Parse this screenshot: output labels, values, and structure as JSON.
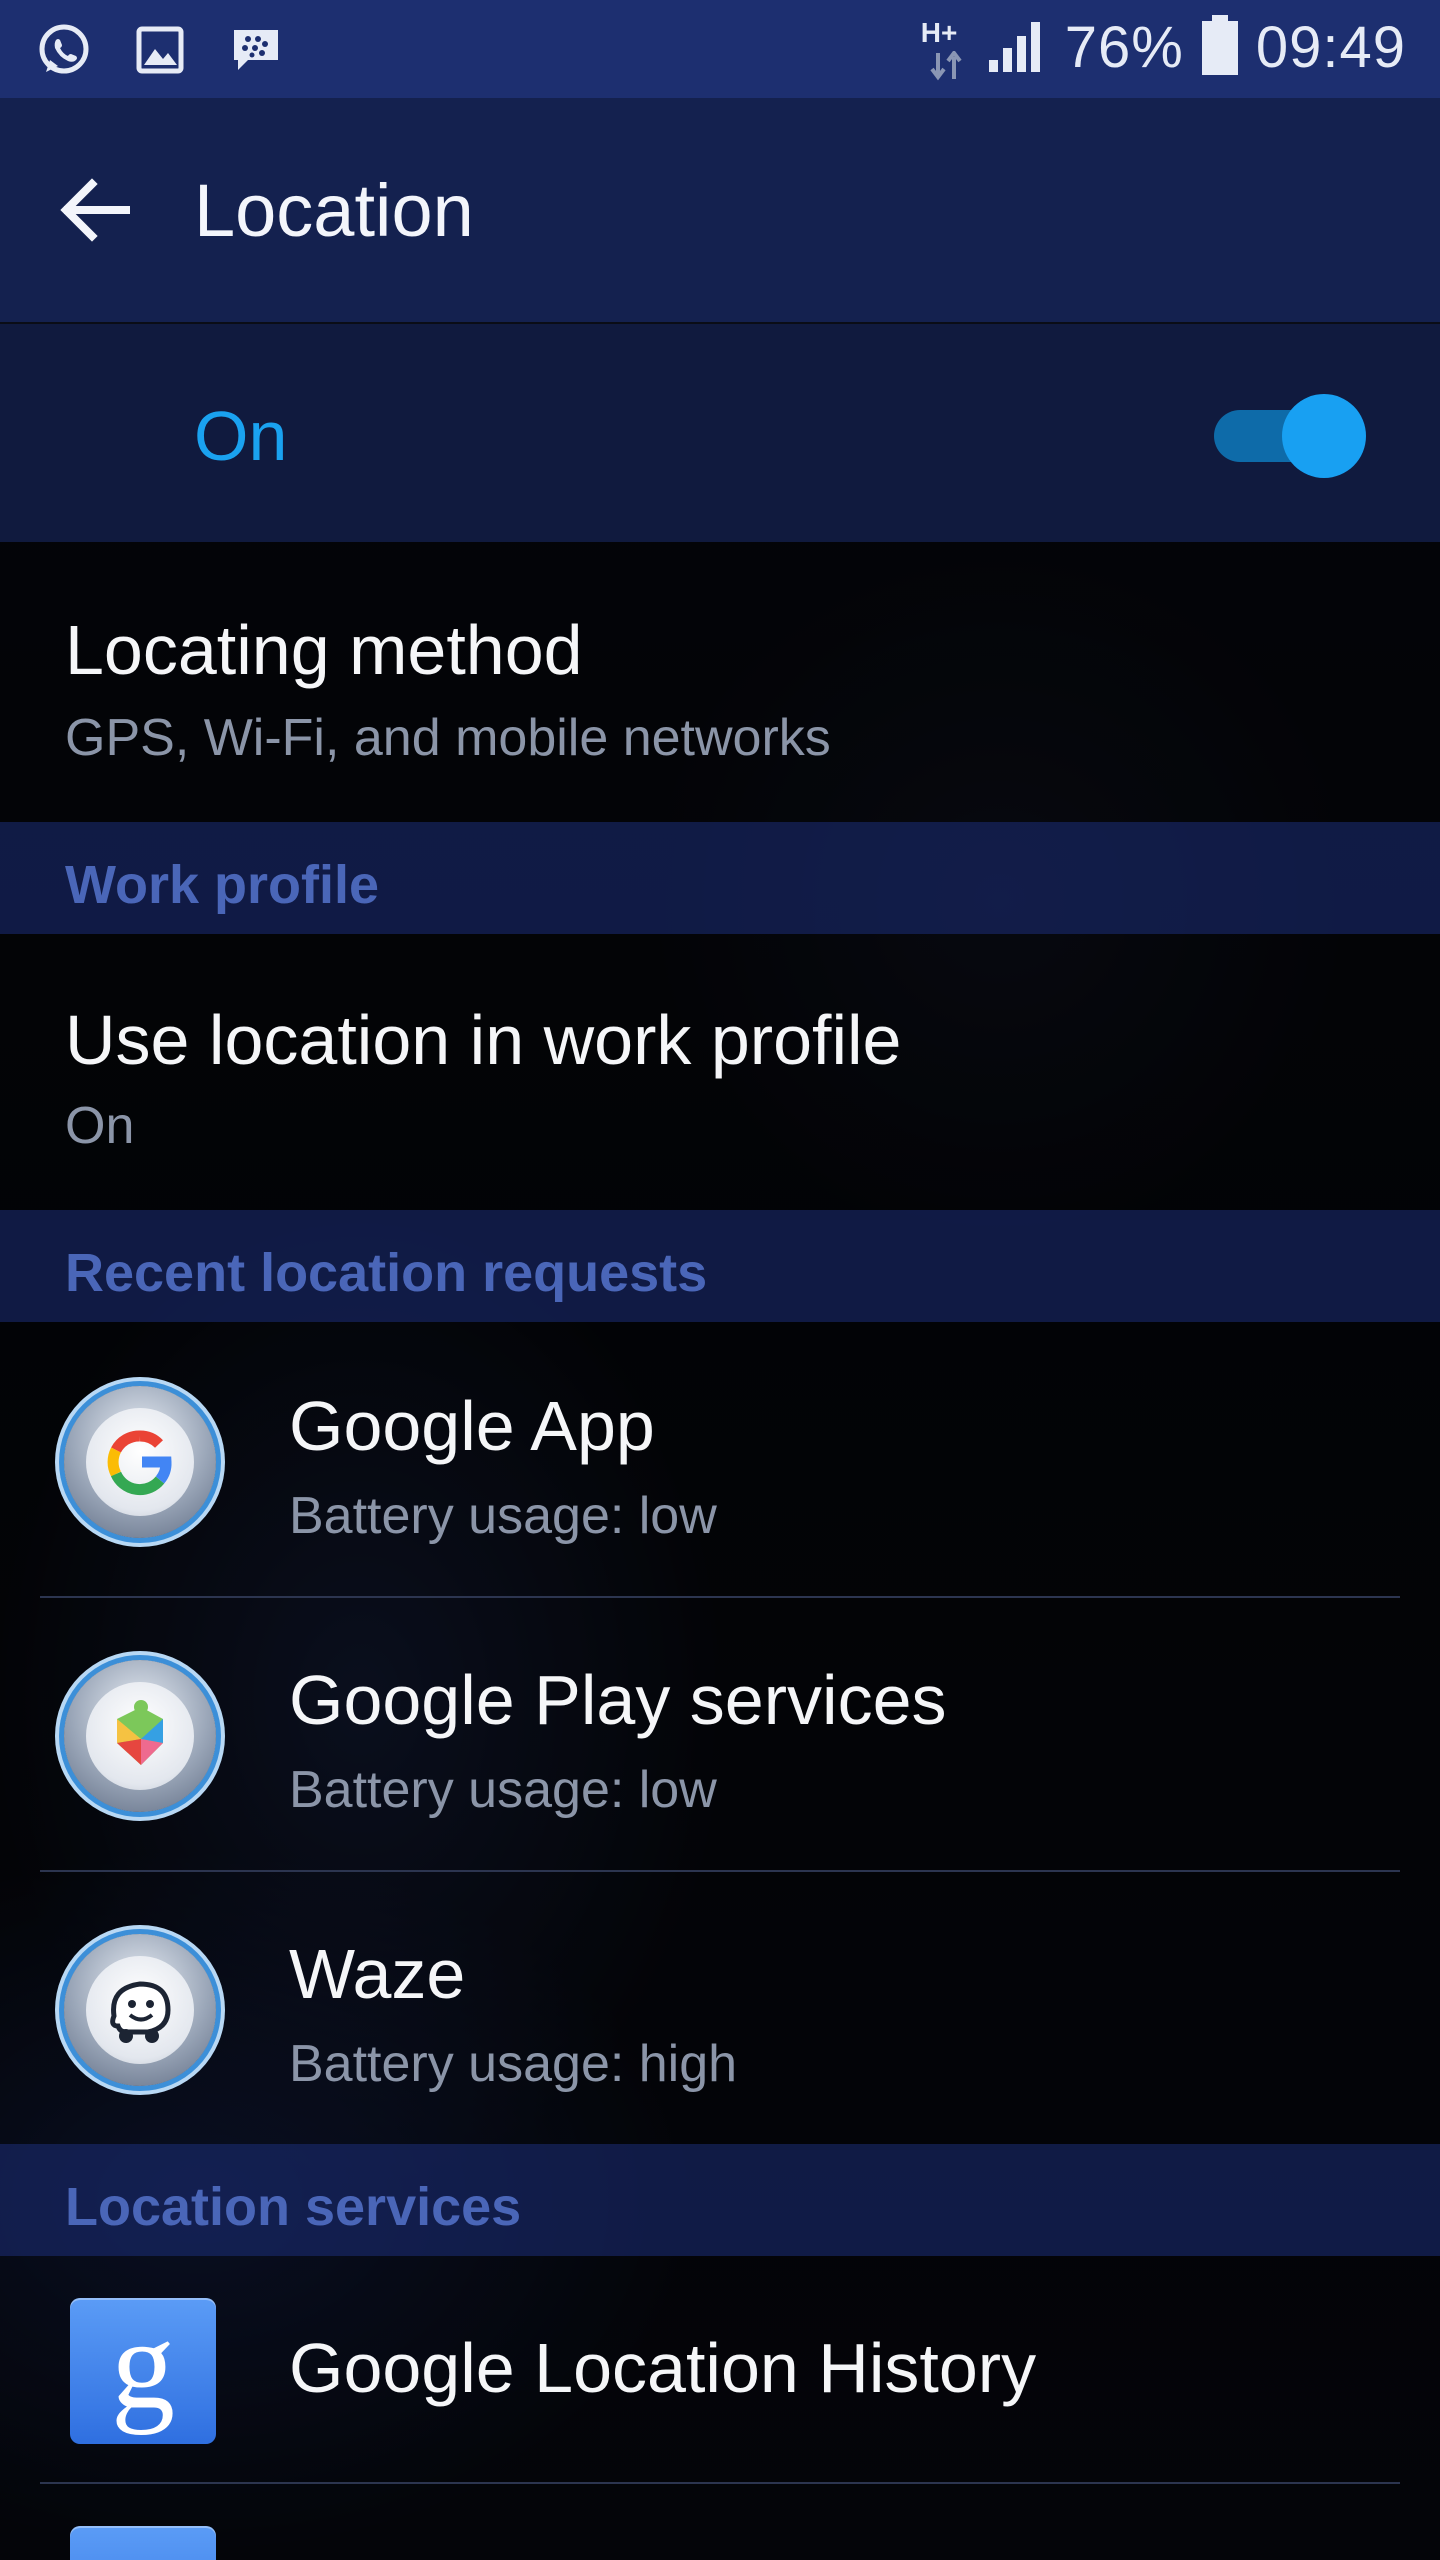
{
  "status_bar": {
    "battery_percent": "76%",
    "time": "09:49",
    "network_type": "H+",
    "icons": [
      "whatsapp-icon",
      "gallery-icon",
      "blackberry-messenger-icon",
      "network-type-icon",
      "signal-icon",
      "battery-icon"
    ]
  },
  "app_bar": {
    "title": "Location"
  },
  "master_switch": {
    "label": "On",
    "checked": true,
    "accent": "#1aa2f0"
  },
  "locating_method": {
    "title": "Locating method",
    "summary": "GPS, Wi-Fi, and mobile networks"
  },
  "work_profile": {
    "header": "Work profile",
    "item": {
      "title": "Use location in work profile",
      "summary": "On"
    }
  },
  "recent_requests": {
    "header": "Recent location requests",
    "items": [
      {
        "name": "Google App",
        "battery": "Battery usage: low",
        "icon": "google-app-icon"
      },
      {
        "name": "Google Play services",
        "battery": "Battery usage: low",
        "icon": "play-services-icon"
      },
      {
        "name": "Waze",
        "battery": "Battery usage: high",
        "icon": "waze-icon"
      }
    ]
  },
  "location_services": {
    "header": "Location services",
    "items": [
      {
        "name": "Google Location History",
        "icon": "google-location-history-icon",
        "glyph": "g"
      }
    ]
  },
  "colors": {
    "status_bar": "#1d2f70",
    "app_bar": "#14214f",
    "section_header_text": "#4a66b8"
  }
}
